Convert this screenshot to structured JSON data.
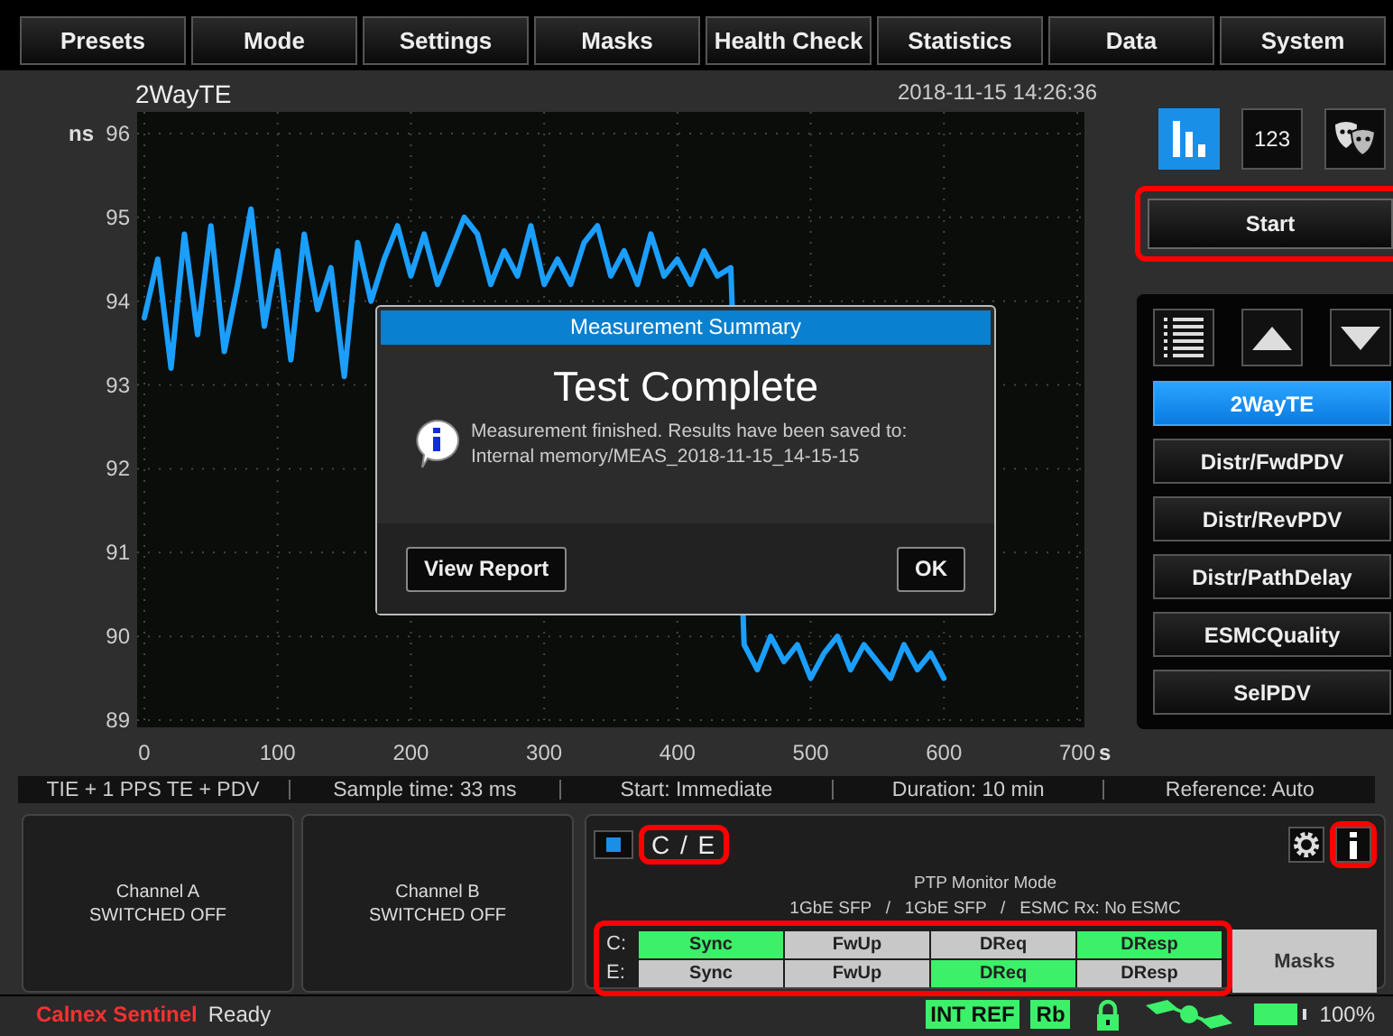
{
  "menu": [
    {
      "label": "Presets"
    },
    {
      "label": "Mode"
    },
    {
      "label": "Settings"
    },
    {
      "label": "Masks"
    },
    {
      "label": "Health Check"
    },
    {
      "label": "Statistics"
    },
    {
      "label": "Data"
    },
    {
      "label": "System"
    }
  ],
  "chart_panel": {
    "title": "2WayTE",
    "timestamp": "2018-11-15 14:26:36",
    "chart_data": {
      "type": "line",
      "grid": true,
      "ylabel": "ns",
      "xlabel": "s",
      "xlim": [
        0,
        700
      ],
      "ylim": [
        89,
        96
      ],
      "xticks": [
        0,
        100,
        200,
        300,
        400,
        500,
        600,
        700
      ],
      "yticks": [
        89,
        90,
        91,
        92,
        93,
        94,
        95,
        96
      ],
      "x": [
        0,
        10,
        20,
        30,
        40,
        50,
        60,
        70,
        80,
        90,
        100,
        110,
        120,
        130,
        140,
        150,
        160,
        170,
        180,
        190,
        200,
        210,
        220,
        230,
        240,
        250,
        260,
        270,
        280,
        290,
        300,
        310,
        320,
        330,
        340,
        350,
        360,
        370,
        380,
        390,
        400,
        410,
        420,
        430,
        440,
        450,
        460,
        470,
        480,
        490,
        500,
        510,
        520,
        530,
        540,
        550,
        560,
        570,
        580,
        590,
        600
      ],
      "series": [
        {
          "color": "#1a9fff",
          "values": [
            93.8,
            94.5,
            93.2,
            94.8,
            93.6,
            94.9,
            93.4,
            94.2,
            95.1,
            93.7,
            94.6,
            93.3,
            94.8,
            93.9,
            94.4,
            93.1,
            94.7,
            94.0,
            94.5,
            94.9,
            94.3,
            94.8,
            94.2,
            94.6,
            95.0,
            94.8,
            94.2,
            94.6,
            94.3,
            94.9,
            94.2,
            94.5,
            94.2,
            94.7,
            94.9,
            94.3,
            94.6,
            94.2,
            94.8,
            94.3,
            94.5,
            94.2,
            94.6,
            94.3,
            94.4,
            89.9,
            89.6,
            90.0,
            89.7,
            89.9,
            89.5,
            89.8,
            90.0,
            89.6,
            89.9,
            89.7,
            89.5,
            89.9,
            89.6,
            89.8,
            89.5
          ]
        }
      ]
    }
  },
  "view_buttons": [
    {
      "kind": "graph",
      "selected": true
    },
    {
      "kind": "numeric",
      "label": "123",
      "selected": false
    },
    {
      "kind": "masks",
      "selected": false
    }
  ],
  "start_button": {
    "label": "Start",
    "highlighted": true
  },
  "measurement_list": [
    {
      "label": "2WayTE",
      "selected": true
    },
    {
      "label": "Distr/FwdPDV",
      "selected": false
    },
    {
      "label": "Distr/RevPDV",
      "selected": false
    },
    {
      "label": "Distr/PathDelay",
      "selected": false
    },
    {
      "label": "ESMCQuality",
      "selected": false
    },
    {
      "label": "SelPDV",
      "selected": false
    }
  ],
  "info_bar": [
    "TIE + 1 PPS TE + PDV",
    "Sample time: 33 ms",
    "Start: Immediate",
    "Duration: 10 min",
    "Reference: Auto"
  ],
  "channels": [
    {
      "name": "Channel A",
      "status": "SWITCHED OFF"
    },
    {
      "name": "Channel B",
      "status": "SWITCHED OFF"
    }
  ],
  "ptp_panel": {
    "port_label": "C / E",
    "port_highlighted": true,
    "info_highlighted": true,
    "mode": "PTP Monitor Mode",
    "interfaces": "1GbE SFP   /   1GbE SFP   /   ESMC Rx: No ESMC",
    "grid_highlighted": true,
    "rows": [
      {
        "label": "C:",
        "cells": [
          {
            "label": "Sync",
            "on": true
          },
          {
            "label": "FwUp",
            "on": false
          },
          {
            "label": "DReq",
            "on": false
          },
          {
            "label": "DResp",
            "on": true
          }
        ]
      },
      {
        "label": "E:",
        "cells": [
          {
            "label": "Sync",
            "on": false
          },
          {
            "label": "FwUp",
            "on": false
          },
          {
            "label": "DReq",
            "on": true
          },
          {
            "label": "DResp",
            "on": false
          }
        ]
      }
    ],
    "masks_button": "Masks"
  },
  "dialog": {
    "title": "Measurement Summary",
    "heading": "Test Complete",
    "message": "Measurement finished. Results have been saved to:",
    "path": "Internal memory/MEAS_2018-11-15_14-15-15",
    "buttons": [
      "View Report",
      "OK"
    ]
  },
  "status_bar": {
    "brand": "Calnex Sentinel",
    "state": "Ready",
    "badges": [
      "INT REF",
      "Rb"
    ],
    "battery": "100%"
  }
}
